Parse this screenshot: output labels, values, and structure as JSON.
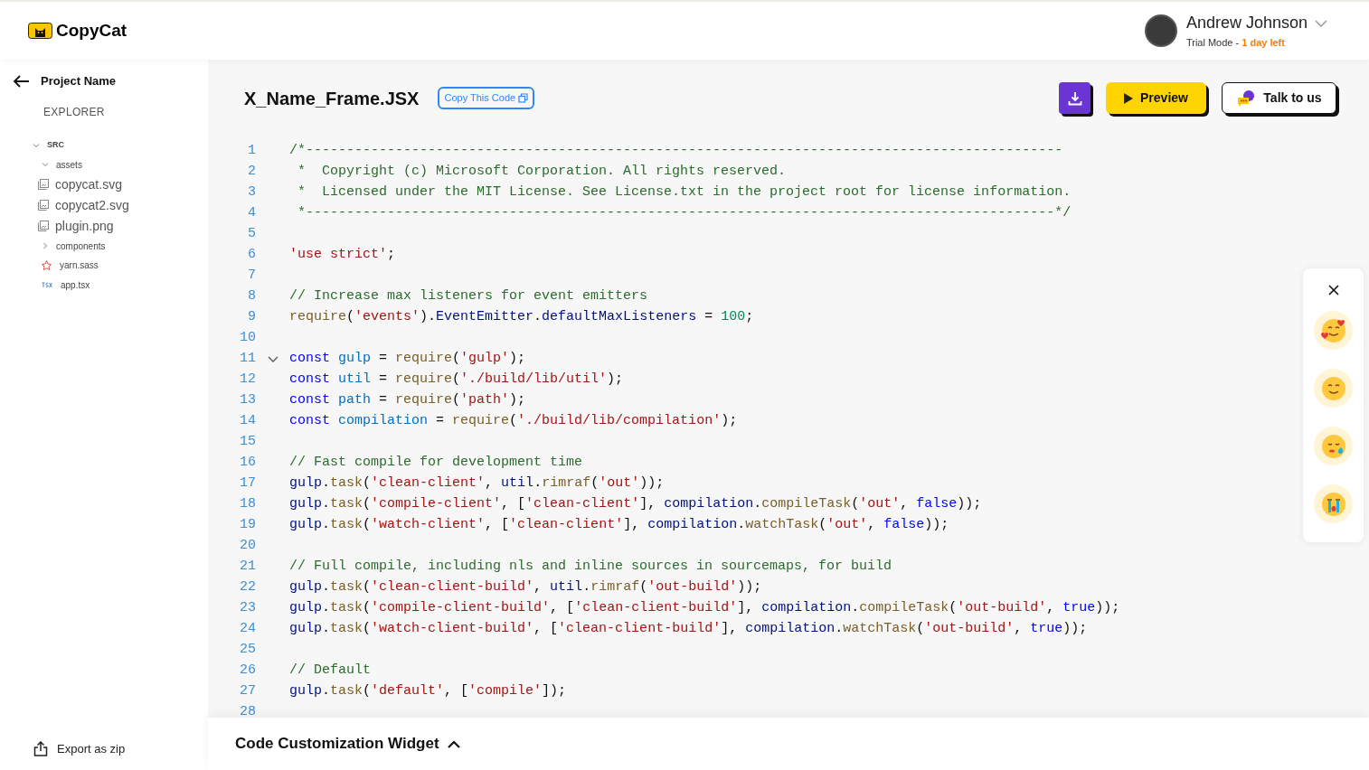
{
  "header": {
    "logo": "CopyCat",
    "user": {
      "name": "Andrew Johnson",
      "plan": "Trial Mode - ",
      "trial_left": "1 day left"
    }
  },
  "sidebar": {
    "project": "Project Name",
    "section": "EXPLORER",
    "tree": [
      {
        "label": "SRC",
        "kind": "folder",
        "expanded": true,
        "children": [
          {
            "label": "assets",
            "kind": "folder",
            "expanded": true,
            "children": [
              {
                "label": "copycat.svg",
                "kind": "image"
              },
              {
                "label": "copycat2.svg",
                "kind": "image"
              },
              {
                "label": "plugin.png",
                "kind": "image"
              }
            ]
          },
          {
            "label": "components",
            "kind": "folder",
            "expanded": false
          },
          {
            "label": "yarn.sass",
            "kind": "sass"
          },
          {
            "label": "app.tsx",
            "kind": "tsx"
          }
        ]
      }
    ],
    "export": "Export as zip"
  },
  "editor": {
    "file": "X_Name_Frame.JSX",
    "copy_button": "Copy This Code",
    "preview_button": "Preview",
    "talk_button": "Talk to us",
    "lines": [
      {
        "number": "1",
        "tokens": [
          {
            "kind": "comment",
            "text": "/*---------------------------------------------------------------------------------------------"
          }
        ]
      },
      {
        "number": "2",
        "tokens": [
          {
            "kind": "comment",
            "text": " *  Copyright (c) Microsoft Corporation. All rights reserved."
          }
        ]
      },
      {
        "number": "3",
        "tokens": [
          {
            "kind": "comment",
            "text": " *  Licensed under the MIT License. See License.txt in the project root for license information."
          }
        ]
      },
      {
        "number": "4",
        "tokens": [
          {
            "kind": "comment",
            "text": " *--------------------------------------------------------------------------------------------*/"
          }
        ]
      },
      {
        "number": "5"
      },
      {
        "number": "6",
        "tokens": [
          {
            "kind": "string",
            "text": "'use strict'"
          },
          {
            "kind": "plain",
            "text": ";"
          }
        ]
      },
      {
        "number": "7"
      },
      {
        "number": "8",
        "tokens": [
          {
            "kind": "comment",
            "text": "// Increase max listeners for event emitters"
          }
        ]
      },
      {
        "number": "9",
        "tokens": [
          {
            "kind": "function",
            "text": "require"
          },
          {
            "kind": "plain",
            "text": "("
          },
          {
            "kind": "string",
            "text": "'events'"
          },
          {
            "kind": "plain",
            "text": ")."
          },
          {
            "kind": "variable",
            "text": "EventEmitter"
          },
          {
            "kind": "plain",
            "text": "."
          },
          {
            "kind": "variable",
            "text": "defaultMaxListeners"
          },
          {
            "kind": "plain",
            "text": " = "
          },
          {
            "kind": "number",
            "text": "100"
          },
          {
            "kind": "plain",
            "text": ";"
          }
        ]
      },
      {
        "number": "10"
      },
      {
        "number": "11",
        "expanded": true,
        "tokens": [
          {
            "kind": "keyword",
            "text": "const"
          },
          {
            "kind": "declared",
            "text": "gulp"
          },
          {
            "kind": "plain",
            "text": " = "
          },
          {
            "kind": "function",
            "text": "require"
          },
          {
            "kind": "plain",
            "text": "("
          },
          {
            "kind": "string",
            "text": "'gulp'"
          },
          {
            "kind": "plain",
            "text": ");"
          }
        ]
      },
      {
        "number": "12",
        "tokens": [
          {
            "kind": "keyword",
            "text": "const"
          },
          {
            "kind": "declared",
            "text": "util"
          },
          {
            "kind": "plain",
            "text": " = "
          },
          {
            "kind": "function",
            "text": "require"
          },
          {
            "kind": "plain",
            "text": "("
          },
          {
            "kind": "string",
            "text": "'./build/lib/util'"
          },
          {
            "kind": "plain",
            "text": ");"
          }
        ]
      },
      {
        "number": "13",
        "tokens": [
          {
            "kind": "keyword",
            "text": "const"
          },
          {
            "kind": "declared",
            "text": "path"
          },
          {
            "kind": "plain",
            "text": " = "
          },
          {
            "kind": "function",
            "text": "require"
          },
          {
            "kind": "plain",
            "text": "("
          },
          {
            "kind": "string",
            "text": "'path'"
          },
          {
            "kind": "plain",
            "text": ");"
          }
        ]
      },
      {
        "number": "14",
        "tokens": [
          {
            "kind": "keyword",
            "text": "const"
          },
          {
            "kind": "declared",
            "text": "compilation"
          },
          {
            "kind": "plain",
            "text": " = "
          },
          {
            "kind": "function",
            "text": "require"
          },
          {
            "kind": "plain",
            "text": "("
          },
          {
            "kind": "string",
            "text": "'./build/lib/compilation'"
          },
          {
            "kind": "plain",
            "text": ");"
          }
        ]
      },
      {
        "number": "15"
      },
      {
        "number": "16",
        "tokens": [
          {
            "kind": "comment",
            "text": "// Fast compile for development time"
          }
        ]
      },
      {
        "number": "17",
        "tokens": [
          {
            "kind": "variable",
            "text": "gulp"
          },
          {
            "kind": "plain",
            "text": "."
          },
          {
            "kind": "function",
            "text": "task"
          },
          {
            "kind": "plain",
            "text": "("
          },
          {
            "kind": "string",
            "text": "'clean-client'"
          },
          {
            "kind": "plain",
            "text": ", "
          },
          {
            "kind": "variable",
            "text": "util"
          },
          {
            "kind": "plain",
            "text": "."
          },
          {
            "kind": "function",
            "text": "rimraf"
          },
          {
            "kind": "plain",
            "text": "("
          },
          {
            "kind": "string",
            "text": "'out'"
          },
          {
            "kind": "plain",
            "text": "));"
          }
        ]
      },
      {
        "number": "18",
        "tokens": [
          {
            "kind": "variable",
            "text": "gulp"
          },
          {
            "kind": "plain",
            "text": "."
          },
          {
            "kind": "function",
            "text": "task"
          },
          {
            "kind": "plain",
            "text": "("
          },
          {
            "kind": "string",
            "text": "'compile-client'"
          },
          {
            "kind": "plain",
            "text": ", ["
          },
          {
            "kind": "string",
            "text": "'clean-client'"
          },
          {
            "kind": "plain",
            "text": "], "
          },
          {
            "kind": "variable",
            "text": "compilation"
          },
          {
            "kind": "plain",
            "text": "."
          },
          {
            "kind": "function",
            "text": "compileTask"
          },
          {
            "kind": "plain",
            "text": "("
          },
          {
            "kind": "string",
            "text": "'out'"
          },
          {
            "kind": "plain",
            "text": ", "
          },
          {
            "kind": "keyword",
            "text": "false"
          },
          {
            "kind": "plain",
            "text": "));"
          }
        ]
      },
      {
        "number": "19",
        "tokens": [
          {
            "kind": "variable",
            "text": "gulp"
          },
          {
            "kind": "plain",
            "text": "."
          },
          {
            "kind": "function",
            "text": "task"
          },
          {
            "kind": "plain",
            "text": "("
          },
          {
            "kind": "string",
            "text": "'watch-client'"
          },
          {
            "kind": "plain",
            "text": ", ["
          },
          {
            "kind": "string",
            "text": "'clean-client'"
          },
          {
            "kind": "plain",
            "text": "], "
          },
          {
            "kind": "variable",
            "text": "compilation"
          },
          {
            "kind": "plain",
            "text": "."
          },
          {
            "kind": "function",
            "text": "watchTask"
          },
          {
            "kind": "plain",
            "text": "("
          },
          {
            "kind": "string",
            "text": "'out'"
          },
          {
            "kind": "plain",
            "text": ", "
          },
          {
            "kind": "keyword",
            "text": "false"
          },
          {
            "kind": "plain",
            "text": "));"
          }
        ]
      },
      {
        "number": "20"
      },
      {
        "number": "21",
        "tokens": [
          {
            "kind": "comment",
            "text": "// Full compile, including nls and inline sources in sourcemaps, for build"
          }
        ]
      },
      {
        "number": "22",
        "tokens": [
          {
            "kind": "variable",
            "text": "gulp"
          },
          {
            "kind": "plain",
            "text": "."
          },
          {
            "kind": "function",
            "text": "task"
          },
          {
            "kind": "plain",
            "text": "("
          },
          {
            "kind": "string",
            "text": "'clean-client-build'"
          },
          {
            "kind": "plain",
            "text": ", "
          },
          {
            "kind": "variable",
            "text": "util"
          },
          {
            "kind": "plain",
            "text": "."
          },
          {
            "kind": "function",
            "text": "rimraf"
          },
          {
            "kind": "plain",
            "text": "("
          },
          {
            "kind": "string",
            "text": "'out-build'"
          },
          {
            "kind": "plain",
            "text": "));"
          }
        ]
      },
      {
        "number": "23",
        "tokens": [
          {
            "kind": "variable",
            "text": "gulp"
          },
          {
            "kind": "plain",
            "text": "."
          },
          {
            "kind": "function",
            "text": "task"
          },
          {
            "kind": "plain",
            "text": "("
          },
          {
            "kind": "string",
            "text": "'compile-client-build'"
          },
          {
            "kind": "plain",
            "text": ", ["
          },
          {
            "kind": "string",
            "text": "'clean-client-build'"
          },
          {
            "kind": "plain",
            "text": "], "
          },
          {
            "kind": "variable",
            "text": "compilation"
          },
          {
            "kind": "plain",
            "text": "."
          },
          {
            "kind": "function",
            "text": "compileTask"
          },
          {
            "kind": "plain",
            "text": "("
          },
          {
            "kind": "string",
            "text": "'out-build'"
          },
          {
            "kind": "plain",
            "text": ", "
          },
          {
            "kind": "keyword",
            "text": "true"
          },
          {
            "kind": "plain",
            "text": "));"
          }
        ]
      },
      {
        "number": "24",
        "tokens": [
          {
            "kind": "variable",
            "text": "gulp"
          },
          {
            "kind": "plain",
            "text": "."
          },
          {
            "kind": "function",
            "text": "task"
          },
          {
            "kind": "plain",
            "text": "("
          },
          {
            "kind": "string",
            "text": "'watch-client-build'"
          },
          {
            "kind": "plain",
            "text": ", ["
          },
          {
            "kind": "string",
            "text": "'clean-client-build'"
          },
          {
            "kind": "plain",
            "text": "], "
          },
          {
            "kind": "variable",
            "text": "compilation"
          },
          {
            "kind": "plain",
            "text": "."
          },
          {
            "kind": "function",
            "text": "watchTask"
          },
          {
            "kind": "plain",
            "text": "("
          },
          {
            "kind": "string",
            "text": "'out-build'"
          },
          {
            "kind": "plain",
            "text": ", "
          },
          {
            "kind": "keyword",
            "text": "true"
          },
          {
            "kind": "plain",
            "text": "));"
          }
        ]
      },
      {
        "number": "25"
      },
      {
        "number": "26",
        "tokens": [
          {
            "kind": "comment",
            "text": "// Default"
          }
        ]
      },
      {
        "number": "27",
        "tokens": [
          {
            "kind": "variable",
            "text": "gulp"
          },
          {
            "kind": "plain",
            "text": "."
          },
          {
            "kind": "function",
            "text": "task"
          },
          {
            "kind": "plain",
            "text": "("
          },
          {
            "kind": "string",
            "text": "'default'"
          },
          {
            "kind": "plain",
            "text": ", ["
          },
          {
            "kind": "string",
            "text": "'compile'"
          },
          {
            "kind": "plain",
            "text": "]);"
          }
        ]
      },
      {
        "number": "28"
      }
    ]
  },
  "widget": {
    "title": "Code Customization Widget",
    "expanded": false
  },
  "feedback": {
    "reactions": [
      {
        "kind": "love"
      },
      {
        "kind": "happy"
      },
      {
        "kind": "sad"
      },
      {
        "kind": "crying"
      }
    ]
  }
}
